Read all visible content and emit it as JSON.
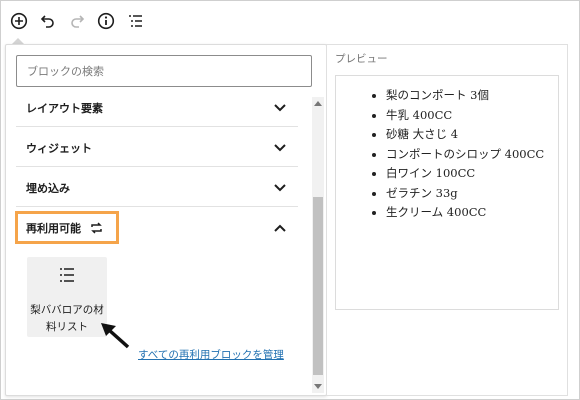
{
  "toolbar": {
    "buttons": [
      {
        "name": "add-block-icon",
        "label": "add"
      },
      {
        "name": "undo-icon",
        "label": "undo"
      },
      {
        "name": "redo-icon",
        "label": "redo"
      },
      {
        "name": "info-icon",
        "label": "details"
      },
      {
        "name": "list-view-icon",
        "label": "list view"
      }
    ]
  },
  "inserter": {
    "search_placeholder": "ブロックの検索",
    "sections": [
      {
        "label": "レイアウト要素",
        "expanded": false
      },
      {
        "label": "ウィジェット",
        "expanded": false
      },
      {
        "label": "埋め込み",
        "expanded": false
      },
      {
        "label": "再利用可能",
        "expanded": true,
        "icon": "reusable-icon"
      }
    ],
    "reusable_blocks": [
      {
        "label": "梨ババロアの材料リスト",
        "icon": "list-icon"
      }
    ],
    "manage_link": "すべての再利用ブロックを管理",
    "highlight_color": "#f5a44a",
    "link_color": "#2271b1"
  },
  "preview": {
    "label": "プレビュー",
    "items": [
      "梨のコンポート 3個",
      "牛乳 400CC",
      "砂糖 大さじ 4",
      "コンポートのシロップ 400CC",
      "白ワイン 100CC",
      "ゼラチン 33g",
      "生クリーム 400CC"
    ]
  }
}
